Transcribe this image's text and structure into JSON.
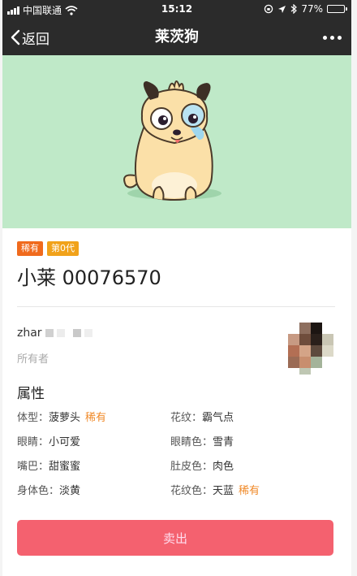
{
  "status_bar": {
    "carrier": "中国联通",
    "time": "15:12",
    "battery": "77%",
    "battery_level": 0.77
  },
  "nav": {
    "back_label": "返回",
    "title": "莱茨狗"
  },
  "pet": {
    "tags": [
      {
        "label": "稀有",
        "color": "#f06a1d"
      },
      {
        "label": "第0代",
        "color": "#f1a21a"
      }
    ],
    "name": "小莱 00076570",
    "hero_bg": "#bfe9c8"
  },
  "owner": {
    "name": "zhar",
    "label": "所有者"
  },
  "attributes": {
    "title": "属性",
    "items": [
      {
        "key": "体型：",
        "value": "菠萝头",
        "rare": "稀有"
      },
      {
        "key": "花纹：",
        "value": "霸气点",
        "rare": ""
      },
      {
        "key": "眼睛：",
        "value": "小可爱",
        "rare": ""
      },
      {
        "key": "眼睛色：",
        "value": "雪青",
        "rare": ""
      },
      {
        "key": "嘴巴：",
        "value": "甜蜜蜜",
        "rare": ""
      },
      {
        "key": "肚皮色：",
        "value": "肉色",
        "rare": ""
      },
      {
        "key": "身体色：",
        "value": "淡黄",
        "rare": ""
      },
      {
        "key": "花纹色：",
        "value": "天蓝",
        "rare": "稀有"
      }
    ]
  },
  "actions": {
    "sell_label": "卖出"
  },
  "colors": {
    "rare_text": "#f08a2a",
    "sell_button": "#f4616f",
    "nav_bg": "#2b2b2b"
  }
}
